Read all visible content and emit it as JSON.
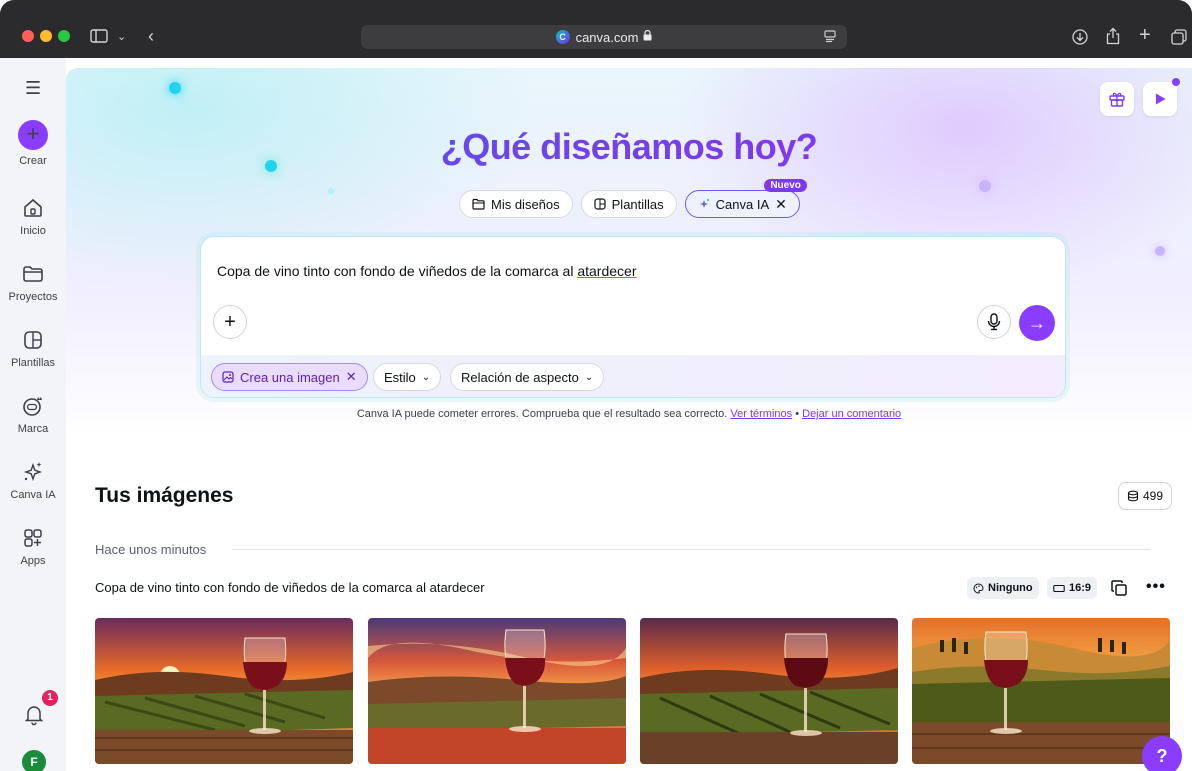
{
  "browser": {
    "url": "canva.com"
  },
  "sidebar": {
    "items": [
      {
        "label": "Crear",
        "icon": "plus-icon"
      },
      {
        "label": "Inicio",
        "icon": "home-icon"
      },
      {
        "label": "Proyectos",
        "icon": "folder-icon"
      },
      {
        "label": "Plantillas",
        "icon": "templates-icon"
      },
      {
        "label": "Marca",
        "icon": "brand-icon"
      },
      {
        "label": "Canva IA",
        "icon": "sparkles-icon"
      },
      {
        "label": "Apps",
        "icon": "apps-icon"
      }
    ],
    "notifications_count": "1",
    "avatar_initial": "F"
  },
  "hero": {
    "title": "¿Qué diseñamos hoy?",
    "tabs": [
      {
        "label": "Mis diseños",
        "icon": "folder-icon"
      },
      {
        "label": "Plantillas",
        "icon": "templates-icon"
      },
      {
        "label": "Canva IA",
        "icon": "sparkles-icon",
        "badge": "Nuevo",
        "active": true
      }
    ]
  },
  "prompt": {
    "text_before": "Copa de vino tinto con fondo de viñedos de la comarca al ",
    "text_flagged": "atardecer",
    "chips": [
      {
        "label": "Crea una imagen",
        "selected": true
      },
      {
        "label": "Estilo"
      },
      {
        "label": "Relación de aspecto"
      }
    ]
  },
  "disclaimer": {
    "text": "Canva IA puede cometer errores. Comprueba que el resultado sea correcto. ",
    "terms_link": "Ver términos",
    "separator": " • ",
    "feedback_link": "Dejar un comentario"
  },
  "images": {
    "title": "Tus imágenes",
    "credits": "499",
    "time_label": "Hace unos minutos",
    "prompt": "Copa de vino tinto con fondo de viñedos de la comarca al atardecer",
    "style": "Ninguno",
    "aspect": "16:9"
  },
  "help_label": "?",
  "colors": {
    "accent": "#8b3dff",
    "wine": "#7a0f1c",
    "sunset": "#f59e0b"
  }
}
